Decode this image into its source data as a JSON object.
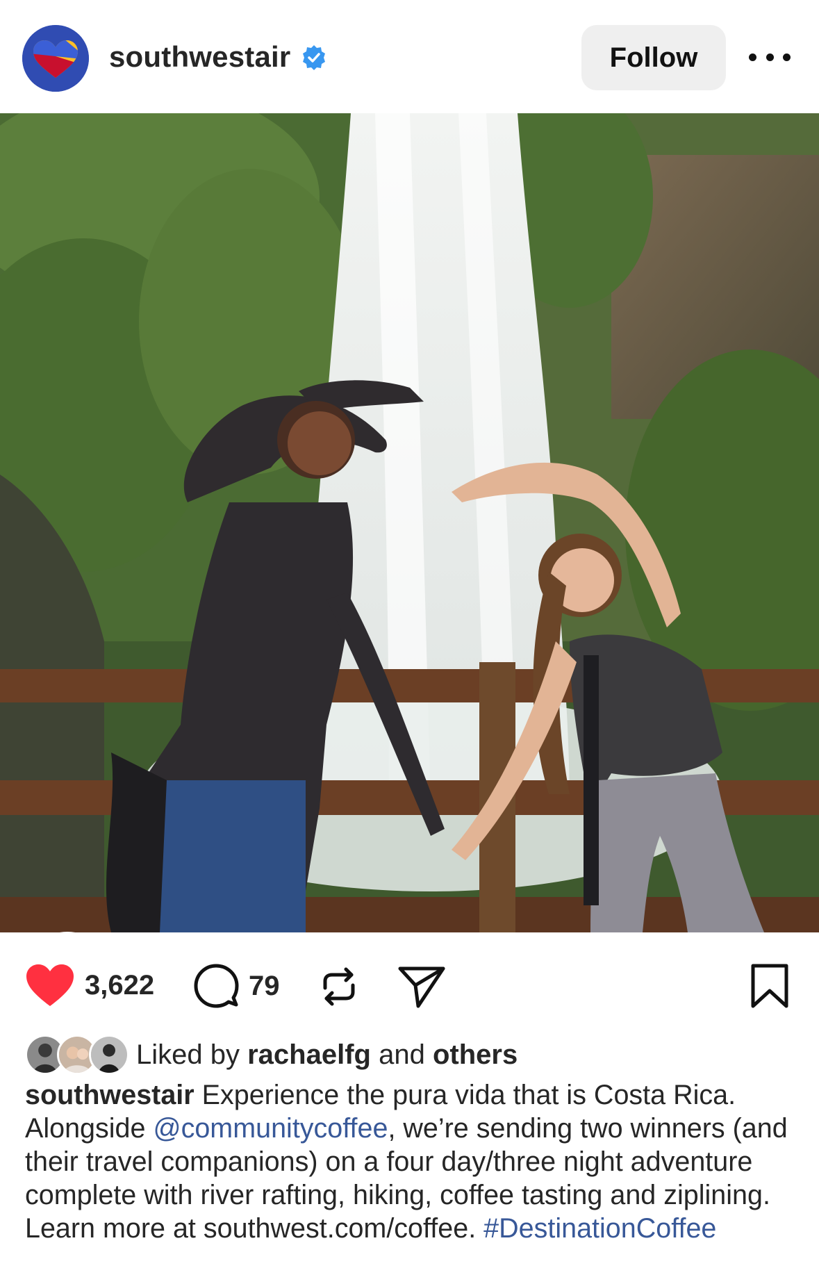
{
  "header": {
    "username": "southwestair",
    "follow_label": "Follow"
  },
  "photo": {
    "description_icon": "photo-image"
  },
  "actions": {
    "likes": "3,622",
    "comments": "79"
  },
  "liked_by": {
    "prefix": "Liked by",
    "user": "rachaelfg",
    "and": "and",
    "others": "others"
  },
  "caption": {
    "username": "southwestair",
    "text_1": "Experience the pura vida that is Costa Rica. Alongside",
    "mention": "@communitycoffee",
    "text_2": ", we’re sending two winners (and their travel companions) on a four day/three night adventure complete with river rafting, hiking, coffee tasting and ziplining. Learn more at southwest.com/coffee.",
    "hashtag": "#DestinationCoffee"
  },
  "colors": {
    "like_red": "#ff3040",
    "link_blue": "#385898",
    "verified_blue": "#3897f0",
    "brand_blue": "#304cb2"
  }
}
